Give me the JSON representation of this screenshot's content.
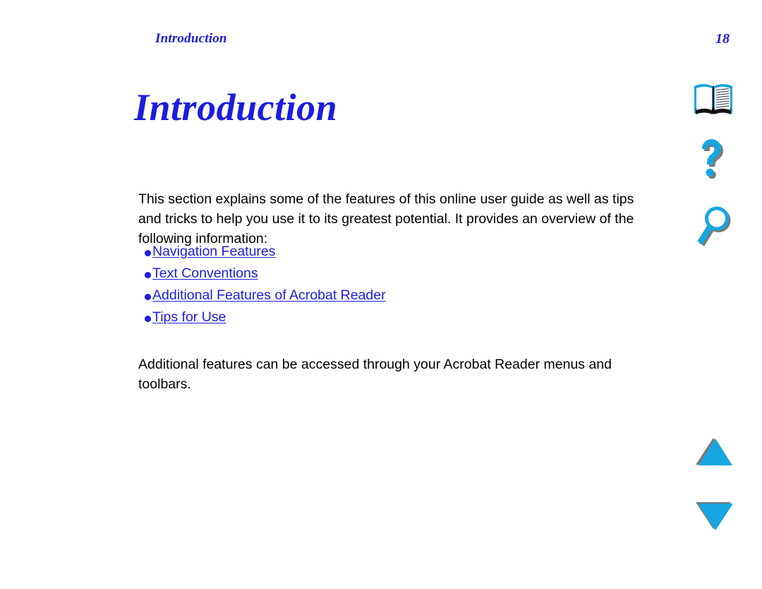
{
  "document": {
    "running_header": "Introduction",
    "page_number": "18",
    "chapter_title": "Introduction"
  },
  "content": {
    "intro_paragraph": "This section explains some of the features of this online user guide as well as tips and tricks to help you use it to its greatest potential. It provides an overview of the following information:",
    "closing_paragraph": "Additional features can be accessed through your Acrobat Reader menus and toolbars.",
    "links": [
      {
        "label": "Navigation Features"
      },
      {
        "label": "Text Conventions"
      },
      {
        "label": "Additional Features of Acrobat Reader"
      },
      {
        "label": "Tips for Use"
      }
    ],
    "bullet_glyph": "•"
  },
  "icon_rail": [
    {
      "name": "book-icon",
      "label": "Table of Contents"
    },
    {
      "name": "help-icon",
      "label": "Help"
    },
    {
      "name": "search-icon",
      "label": "Find"
    },
    {
      "name": "up-arrow-icon",
      "label": "Previous Page"
    },
    {
      "name": "down-arrow-icon",
      "label": "Next Page"
    }
  ],
  "colors": {
    "link_blue": "#1c1ce0",
    "icon_cyan": "#17a6e0",
    "icon_shadow": "#7a7a7a",
    "text_black": "#000000",
    "page_background": "#ffffff"
  }
}
